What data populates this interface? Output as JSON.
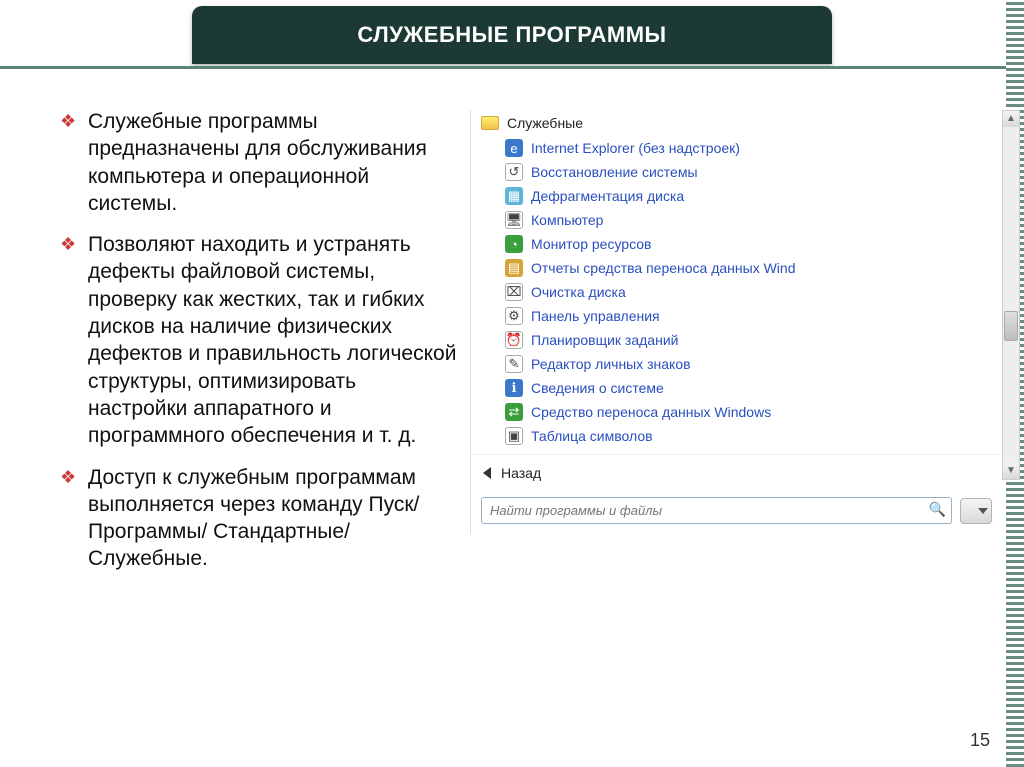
{
  "header": {
    "title": "СЛУЖЕБНЫЕ ПРОГРАММЫ"
  },
  "bullets": [
    "Служебные программы предназначены для обслуживания компьютера и операционной системы.",
    "Позволяют находить и устранять дефекты файловой системы, проверку как жестких, так и гибких дисков на наличие физических дефектов и правильность логической структуры, оптимизировать настройки аппаратного и программного обеспечения и т. д.",
    "Доступ к служебным программам выполняется через команду Пуск/Программы/ Стандартные/Служебные."
  ],
  "menu": {
    "folder_label": "Служебные",
    "items": [
      {
        "label": "Internet Explorer (без надстроек)",
        "icon": "ie-icon"
      },
      {
        "label": "Восстановление системы",
        "icon": "restore-icon"
      },
      {
        "label": "Дефрагментация диска",
        "icon": "defrag-icon"
      },
      {
        "label": "Компьютер",
        "icon": "computer-icon"
      },
      {
        "label": "Монитор ресурсов",
        "icon": "monitor-icon"
      },
      {
        "label": "Отчеты средства переноса данных Wind",
        "icon": "reports-icon"
      },
      {
        "label": "Очистка диска",
        "icon": "cleanup-icon"
      },
      {
        "label": "Панель управления",
        "icon": "control-panel-icon"
      },
      {
        "label": "Планировщик заданий",
        "icon": "scheduler-icon"
      },
      {
        "label": "Редактор личных знаков",
        "icon": "char-editor-icon"
      },
      {
        "label": "Сведения о системе",
        "icon": "sysinfo-icon"
      },
      {
        "label": "Средство переноса данных Windows",
        "icon": "transfer-icon"
      },
      {
        "label": "Таблица символов",
        "icon": "charmap-icon"
      }
    ],
    "back_label": "Назад",
    "search_placeholder": "Найти программы и файлы"
  },
  "page_number": "15"
}
